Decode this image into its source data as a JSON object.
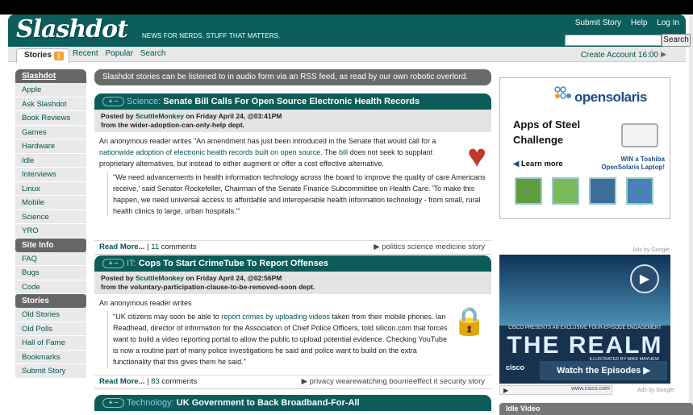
{
  "header": {
    "logo": "Slashdot",
    "slogan": "NEWS FOR NERDS. STUFF THAT MATTERS.",
    "links": [
      "Submit Story",
      "Help",
      "Log In"
    ],
    "search_button": "Search"
  },
  "nav": {
    "stories_tab": "Stories",
    "links": [
      "Recent",
      "Popular",
      "Search"
    ],
    "create_account": "Create Account",
    "time": "16:00"
  },
  "sidebar": {
    "sections": [
      {
        "title": "Slashdot",
        "items": [
          "Apple",
          "Ask Slashdot",
          "Book Reviews",
          "Games",
          "Hardware",
          "Idle",
          "Interviews",
          "Linux",
          "Mobile",
          "Science",
          "YRO"
        ]
      },
      {
        "title": "Site Info",
        "items": [
          "FAQ",
          "Bugs",
          "Code"
        ]
      },
      {
        "title": "Stories",
        "items": [
          "Old Stories",
          "Old Polls",
          "Hall of Fame",
          "Bookmarks",
          "Submit Story"
        ]
      }
    ]
  },
  "rss_notice": {
    "text": "Slashdot stories can be listened to in audio form via an RSS feed, as ",
    "link": "read by our own robotic overlord",
    "end": "."
  },
  "stories": [
    {
      "topic": "Science:",
      "title": "Senate Bill Calls For Open Source Electronic Health Records",
      "posted_prefix": "Posted by",
      "author": "ScuttleMonkey",
      "posted_suffix": " on Friday April 24, @03:41PM",
      "dept": "from the wider-adoption-can-only-help dept.",
      "p1_a": "An anonymous reader writes \"An amendment has just been introduced in the Senate that would call for a ",
      "p1_link": "nationwide adoption of electronic health records built on open source",
      "p1_b": ". The ",
      "p1_link2": "bill",
      "p1_c": " does not seek to supplant proprietary alternatives, but instead to either augment or offer a cost effective alternative.",
      "quote": "\"We need advancements in health information technology across the board to improve the quality of care Americans receive,' said Senator Rockefeller, Chairman of the Senate Finance Subcommittee on Health Care. 'To make this happen, we need universal access to affordable and interoperable health information technology - from small, rural health clinics to large, urban hospitals.'\"",
      "read_more": "Read More...",
      "comments_count": "11",
      "comments_label": " comments",
      "tags": "politics science medicine story"
    },
    {
      "topic": "IT:",
      "title": "Cops To Start CrimeTube To Report Offenses",
      "posted_prefix": "Posted by",
      "author": "ScuttleMonkey",
      "posted_suffix": " on Friday April 24, @02:56PM",
      "dept": "from the voluntary-participation-clause-to-be-removed-soon dept.",
      "intro": "An anonymous reader writes",
      "q_a": "\"UK citizens may soon be able to ",
      "q_link": "report crimes by uploading videos",
      "q_b": " taken from their mobile phones. Ian Readhead, director of information for the Association of Chief Police Officers, told silicon.com that forces want to build a video reporting portal to allow the public to upload potential evidence. Checking YouTube is now a routine part of many police investigations he said and police want to build on the extra functionality that this gives them he said.\"",
      "read_more": "Read More...",
      "comments_count": "83",
      "comments_label": " comments",
      "tags": "privacy wearewatching bourneeffect it security story"
    },
    {
      "topic": "Technology:",
      "title": "UK Government to Back Broadband-For-All"
    }
  ],
  "ad1": {
    "brand": "opensolaris",
    "headline1": "Apps of Steel",
    "headline2": "Challenge",
    "learn_more": "Learn more",
    "win": "WIN a Toshiba OpenSolaris Laptop!"
  },
  "ad2": {
    "ads_by": "Ads by Google",
    "promo": "CISCO PRESENTS AN EXCLUSIVE FOUR-EPISODE ENGAGEMENT",
    "title": "THE REALM",
    "illustrated": "ILLUSTRATED BY MIKE MAYHEW",
    "brand": "cisco",
    "watch": "Watch the Episodes",
    "url": "www.cisco.com",
    "ads_by2": "Ads by Google"
  },
  "idle_video": "Idle Video"
}
